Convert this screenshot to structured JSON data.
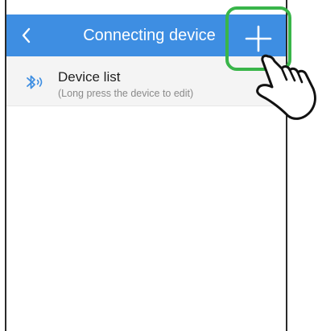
{
  "header": {
    "title": "Connecting device",
    "back_icon": "chevron-left-icon",
    "add_icon": "plus-icon",
    "background_color": "#3e8ee2"
  },
  "device_list": {
    "title": "Device list",
    "hint": "(Long press the device to edit)",
    "icon": "bluetooth-icon"
  },
  "annotation": {
    "highlight_color": "#39b54a",
    "pointer_icon": "hand-pointer-icon"
  }
}
